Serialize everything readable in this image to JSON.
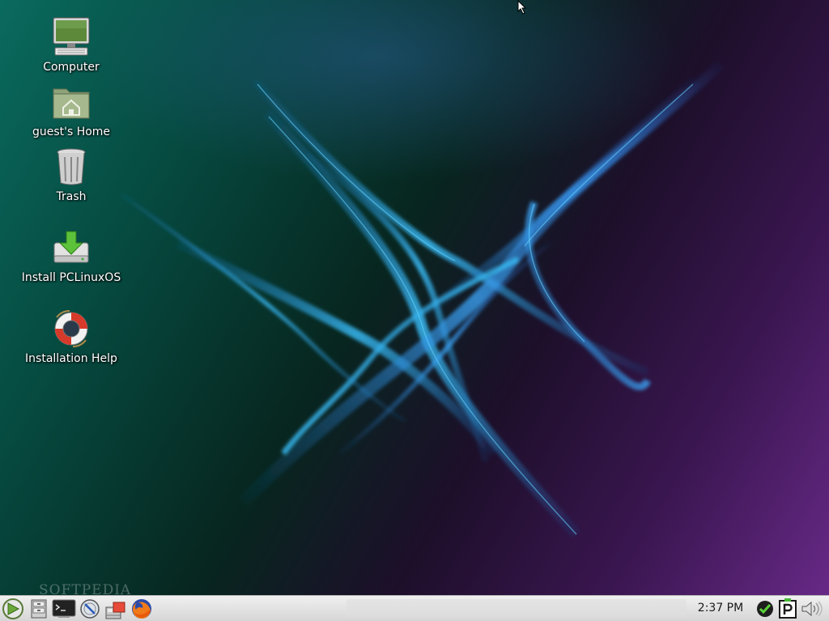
{
  "desktop": {
    "icons": [
      {
        "label": "Computer",
        "icon": "computer-icon"
      },
      {
        "label": "guest's Home",
        "icon": "home-folder-icon"
      },
      {
        "label": "Trash",
        "icon": "trash-icon"
      },
      {
        "label": "Install PCLinuxOS",
        "icon": "install-icon"
      },
      {
        "label": "Installation Help",
        "icon": "lifebuoy-icon"
      }
    ],
    "watermark": "SOFTPEDIA"
  },
  "panel": {
    "launchers": [
      {
        "name": "menu-icon"
      },
      {
        "name": "file-manager-icon"
      },
      {
        "name": "terminal-icon"
      },
      {
        "name": "control-center-icon"
      },
      {
        "name": "package-manager-icon"
      },
      {
        "name": "firefox-icon"
      }
    ],
    "clock": "2:37 PM",
    "tray": [
      {
        "name": "update-check-icon"
      },
      {
        "name": "pclinuxos-icon"
      },
      {
        "name": "volume-icon"
      }
    ]
  },
  "colors": {
    "panel_bg": "#e2e2e2",
    "wallpaper_teal": "#0a6a5e",
    "wallpaper_purple": "#6a2a8a",
    "wallpaper_blue": "#2aa8e8"
  }
}
